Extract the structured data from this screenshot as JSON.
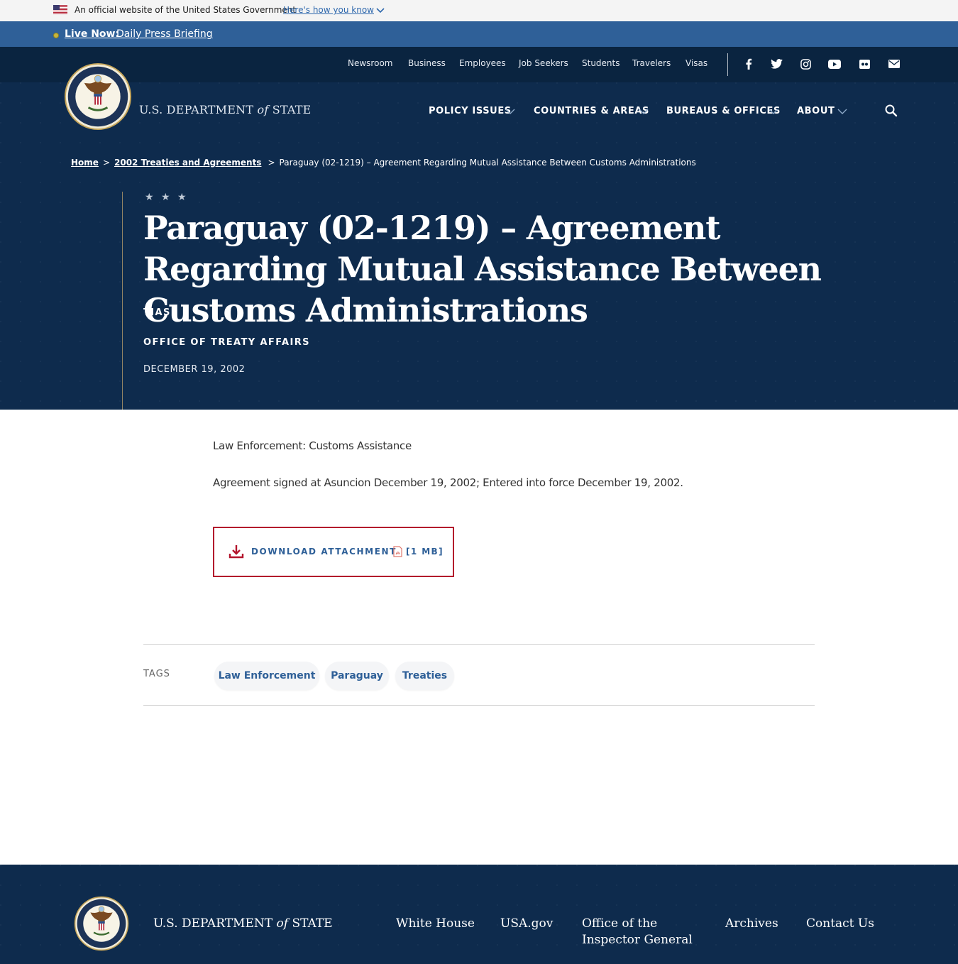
{
  "gov_banner": {
    "text": "An official website of the United States Government",
    "link": "Here's how you know"
  },
  "live_bar": {
    "label": "Live Now:",
    "link": "Daily Press Briefing"
  },
  "utility_nav": [
    "Newsroom",
    "Business",
    "Employees",
    "Job Seekers",
    "Students",
    "Travelers",
    "Visas"
  ],
  "social_icons": [
    "facebook-icon",
    "twitter-icon",
    "instagram-icon",
    "youtube-icon",
    "flickr-icon",
    "email-icon"
  ],
  "header": {
    "wordmark_pre": "U.S. DEPARTMENT",
    "wordmark_of": "of",
    "wordmark_post": "STATE"
  },
  "main_nav": [
    "POLICY ISSUES",
    "COUNTRIES & AREAS",
    "BUREAUS & OFFICES",
    "ABOUT"
  ],
  "breadcrumb": {
    "home": "Home",
    "section": "2002 Treaties and Agreements",
    "sep": ">",
    "current": "Paraguay (02-1219) – Agreement Regarding Mutual Assistance Between Customs Administrations"
  },
  "hero": {
    "stars": "★ ★ ★",
    "title": "Paraguay (02-1219) – Agreement Regarding Mutual Assistance Between Customs Administrations",
    "category": "TIAS",
    "office": "OFFICE OF TREATY AFFAIRS",
    "date": "DECEMBER 19, 2002"
  },
  "content": {
    "subject": "Law Enforcement: Customs Assistance",
    "summary": "Agreement signed at Asuncion December 19, 2002; Entered into force December 19, 2002.",
    "download_label": "DOWNLOAD ATTACHMENT",
    "download_size": "[1 MB]"
  },
  "tags": {
    "label": "TAGS",
    "items": [
      "Law Enforcement",
      "Paraguay",
      "Treaties"
    ]
  },
  "footer": {
    "wordmark_pre": "U.S. DEPARTMENT",
    "wordmark_of": "of",
    "wordmark_post": "STATE",
    "links": [
      "White House",
      "USA.gov",
      "Office of the Inspector General",
      "Archives",
      "Contact Us"
    ]
  },
  "colors": {
    "navy": "#0e2b4d",
    "live_blue": "#2f6098",
    "accent_red": "#b3142c",
    "link_blue": "#2f6098"
  }
}
